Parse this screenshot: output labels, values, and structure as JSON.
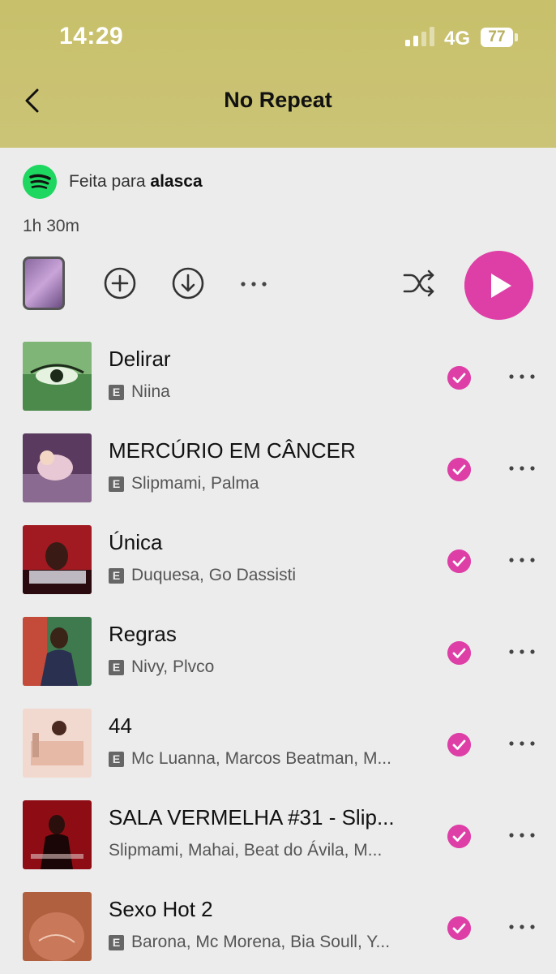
{
  "status": {
    "time": "14:29",
    "network": "4G",
    "battery": "77"
  },
  "header": {
    "title": "No Repeat"
  },
  "playlist": {
    "made_for_prefix": "Feita para ",
    "made_for_user": "alasca",
    "duration": "1h 30m"
  },
  "colors": {
    "accent": "#de3fa7",
    "header_bg": "#c8c06a",
    "spotify_green": "#1ed760"
  },
  "tracks": [
    {
      "title": "Delirar",
      "artists": "Niina",
      "explicit": true
    },
    {
      "title": "MERCÚRIO EM CÂNCER",
      "artists": "Slipmami, Palma",
      "explicit": true
    },
    {
      "title": "Única",
      "artists": "Duquesa, Go Dassisti",
      "explicit": true
    },
    {
      "title": "Regras",
      "artists": "Nivy, Plvco",
      "explicit": true
    },
    {
      "title": "44",
      "artists": "Mc Luanna, Marcos Beatman, M...",
      "explicit": true
    },
    {
      "title": "SALA VERMELHA #31 - Slip...",
      "artists": "Slipmami, Mahai, Beat do Ávila, M...",
      "explicit": false
    },
    {
      "title": "Sexo Hot 2",
      "artists": "Barona, Mc Morena, Bia Soull, Y...",
      "explicit": true
    }
  ]
}
